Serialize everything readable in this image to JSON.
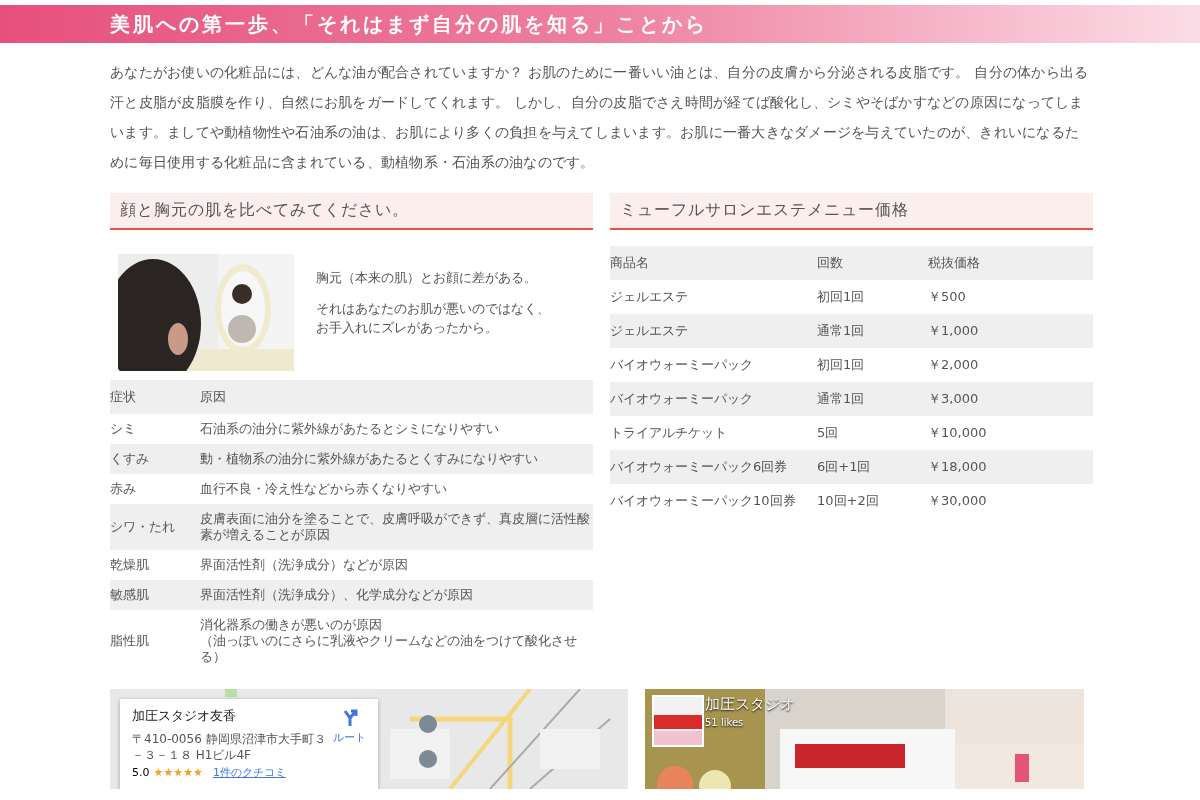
{
  "banner": {
    "title": "美肌への第一歩、「それはまず自分の肌を知る」ことから"
  },
  "intro": "あなたがお使いの化粧品には、どんな油が配合されていますか？ お肌のために一番いい油とは、自分の皮膚から分泌される皮脂です。 自分の体から出る汗と皮脂が皮脂膜を作り、自然にお肌をガードしてくれます。 しかし、自分の皮脂でさえ時間が経てば酸化し、シミやそばかすなどの原因になってしまいます。ましてや動植物性や石油系の油は、お肌により多くの負担を与えてしまいます。お肌に一番大きなダメージを与えていたのが、きれいになるために毎日使用する化粧品に含まれている、動植物系・石油系の油なのです。",
  "skin_section": {
    "heading": "顔と胸元の肌を比べてみてください。",
    "photo": {
      "kind": "picture"
    },
    "lines": [
      [
        "胸元（本来の肌）とお顔に差がある。"
      ],
      [
        "それはあなたのお肌が悪いのではなく、",
        "お手入れにズレがあったから。"
      ]
    ],
    "table": {
      "columns": [
        "症状",
        "原因"
      ],
      "rows": [
        [
          "シミ",
          "石油系の油分に紫外線があたるとシミになりやすい"
        ],
        [
          "くすみ",
          "動・植物系の油分に紫外線があたるとくすみになりやすい"
        ],
        [
          "赤み",
          "血行不良・冷え性などから赤くなりやすい"
        ],
        [
          "シワ・たれ",
          "皮膚表面に油分を塗ることで、皮膚呼吸ができず、真皮層に活性酸素が増えることが原因"
        ],
        [
          "乾燥肌",
          "界面活性剤（洗浄成分）などが原因"
        ],
        [
          "敏感肌",
          "界面活性剤（洗浄成分）、化学成分などが原因"
        ],
        [
          "脂性肌",
          [
            "消化器系の働きが悪いのが原因",
            "（油っぽいのにさらに乳液やクリームなどの油をつけて酸化させる）"
          ]
        ]
      ]
    }
  },
  "price_section": {
    "heading": "ミューフルサロンエステメニュー価格",
    "table": {
      "columns": [
        "商品名",
        "回数",
        "税抜価格"
      ],
      "rows": [
        [
          "ジェルエステ",
          "初回1回",
          "￥500"
        ],
        [
          "ジェルエステ",
          "通常1回",
          "￥1,000"
        ],
        [
          "バイオウォーミーパック",
          "初回1回",
          "￥2,000"
        ],
        [
          "バイオウォーミーパック",
          "通常1回",
          "￥3,000"
        ],
        [
          "トライアルチケット",
          "5回",
          "￥10,000"
        ],
        [
          "バイオウォーミーパック6回券",
          "6回+1回",
          "￥18,000"
        ],
        [
          "バイオウォーミーパック10回券",
          "10回+2回",
          "￥30,000"
        ]
      ]
    }
  },
  "map": {
    "place_name": "加圧スタジオ友香",
    "address": "〒410-0056 静岡県沼津市大手町３－３－１８ H1ビル4F",
    "route_label": "ルート",
    "rating": "5.0",
    "stars": 5,
    "reviews_link": "1件のクチコミ"
  },
  "social": {
    "page_name": "加圧スタジオ",
    "likes": "51 likes"
  }
}
